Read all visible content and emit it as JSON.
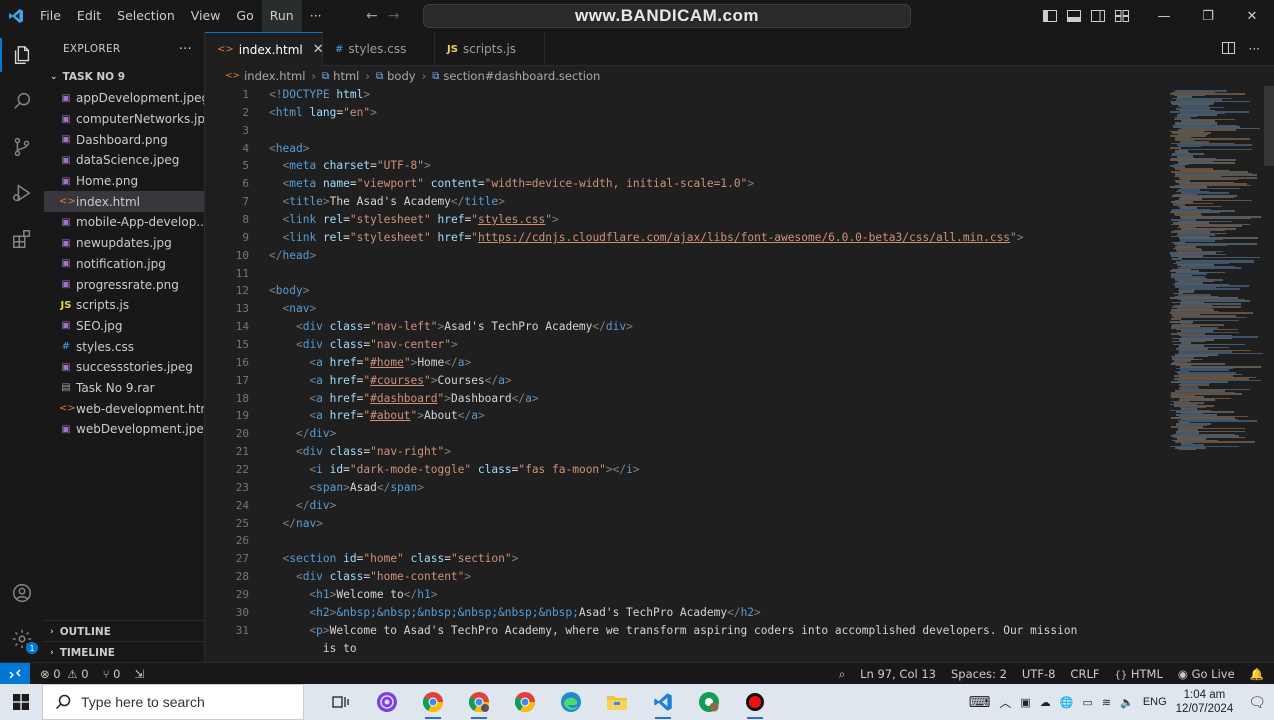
{
  "titlebar": {
    "menu": [
      "File",
      "Edit",
      "Selection",
      "View",
      "Go",
      "Run",
      "···"
    ],
    "watermark": "www.BANDICAM.com",
    "win_minimize": "—",
    "win_maximize": "❐",
    "win_close": "✕"
  },
  "sidebar": {
    "title": "EXPLORER",
    "more": "···",
    "folder": "TASK NO 9",
    "files": [
      {
        "name": "appDevelopment.jpeg",
        "type": "image"
      },
      {
        "name": "computerNetworks.jpg",
        "type": "image"
      },
      {
        "name": "Dashboard.png",
        "type": "image"
      },
      {
        "name": "dataScience.jpeg",
        "type": "image"
      },
      {
        "name": "Home.png",
        "type": "image"
      },
      {
        "name": "index.html",
        "type": "html"
      },
      {
        "name": "mobile-App-develop...",
        "type": "image"
      },
      {
        "name": "newupdates.jpg",
        "type": "image"
      },
      {
        "name": "notification.jpg",
        "type": "image"
      },
      {
        "name": "progressrate.png",
        "type": "image"
      },
      {
        "name": "scripts.js",
        "type": "js"
      },
      {
        "name": "SEO.jpg",
        "type": "image"
      },
      {
        "name": "styles.css",
        "type": "css"
      },
      {
        "name": "successstories.jpeg",
        "type": "image"
      },
      {
        "name": "Task No 9.rar",
        "type": "archive"
      },
      {
        "name": "web-development.html",
        "type": "html"
      },
      {
        "name": "webDevelopment.jpeg",
        "type": "image"
      }
    ],
    "outline": "OUTLINE",
    "timeline": "TIMELINE"
  },
  "tabs": [
    {
      "name": "index.html",
      "type": "html",
      "active": true
    },
    {
      "name": "styles.css",
      "type": "css",
      "active": false
    },
    {
      "name": "scripts.js",
      "type": "js",
      "active": false
    }
  ],
  "breadcrumb": [
    "index.html",
    "html",
    "body",
    "section#dashboard.section"
  ],
  "statusbar": {
    "errors": "0",
    "warnings": "0",
    "ports": "0",
    "position": "Ln 97, Col 13",
    "spaces": "Spaces: 2",
    "encoding": "UTF-8",
    "eol": "CRLF",
    "language": "HTML",
    "golive": "Go Live"
  },
  "taskbar": {
    "search_placeholder": "Type here to search",
    "lang": "ENG",
    "time": "1:04 am",
    "date": "12/07/2024"
  },
  "colors": {
    "accent": "#0078d4",
    "editor_bg": "#1f1f1f",
    "tag": "#569cd6",
    "attr": "#9cdcfe",
    "string": "#ce9178"
  }
}
